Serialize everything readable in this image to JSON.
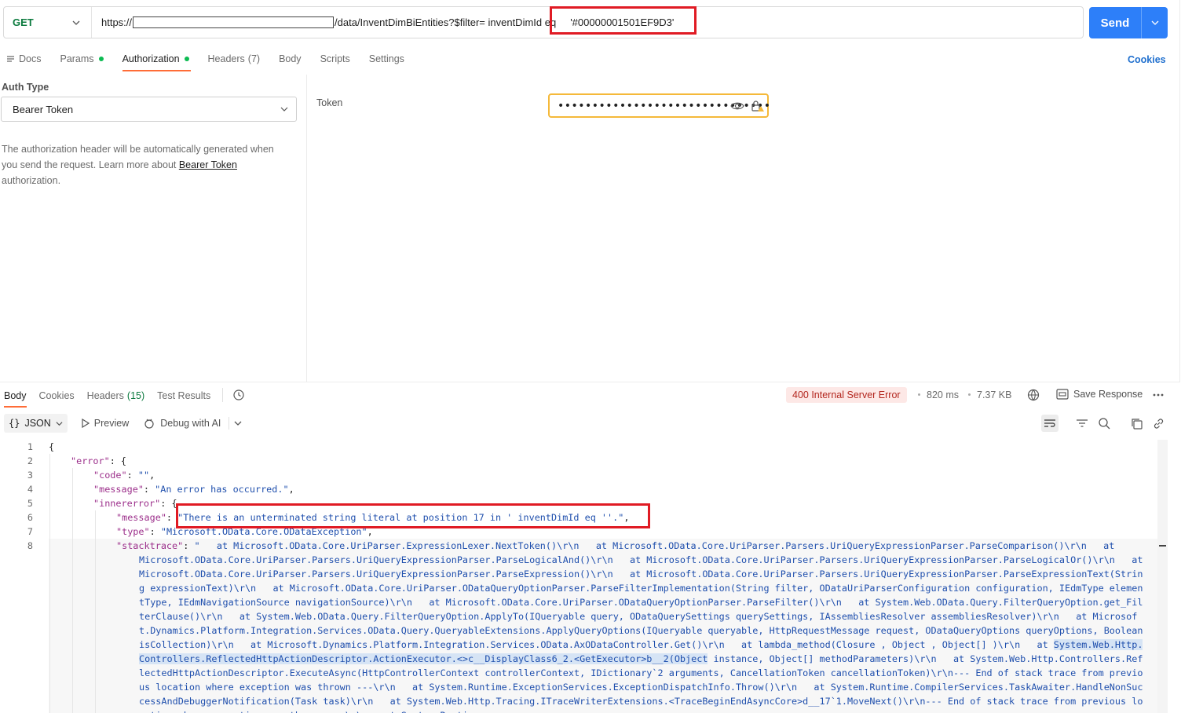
{
  "request": {
    "method": "GET",
    "url_prefix": "https://",
    "url_path": "/data/InventDimBiEntities?$filter= inventDimId eq",
    "filter_value": "'#00000001501EF9D3'",
    "send_label": "Send"
  },
  "req_tabs": {
    "docs": "Docs",
    "params": "Params",
    "authorization": "Authorization",
    "headers": "Headers",
    "headers_count": "(7)",
    "body": "Body",
    "scripts": "Scripts",
    "settings": "Settings",
    "cookies": "Cookies"
  },
  "auth": {
    "type_label": "Auth Type",
    "type_value": "Bearer Token",
    "desc_1": "The authorization header will be automatically generated when you send the request. Learn more about ",
    "desc_link": "Bearer Token",
    "desc_2": " authorization.",
    "token_label": "Token",
    "token_mask": "•••••••••••••••••••••••••••••••"
  },
  "response": {
    "tabs": {
      "body": "Body",
      "cookies": "Cookies",
      "headers": "Headers",
      "headers_count": "(15)",
      "test_results": "Test Results"
    },
    "status": "400 Internal Server Error",
    "time": "820 ms",
    "size": "7.37 KB",
    "save": "Save Response",
    "format": "JSON",
    "preview": "Preview",
    "debug": "Debug with AI"
  },
  "code": {
    "line_numbers": [
      "1",
      "2",
      "3",
      "4",
      "5",
      "6",
      "7",
      "8"
    ],
    "l1": "{",
    "error_key": "\"error\"",
    "code_key": "\"code\"",
    "code_val": "\"\"",
    "message_key": "\"message\"",
    "message_val": "\"An error has occurred.\"",
    "inner_key": "\"innererror\"",
    "inner_msg_key": "\"message\"",
    "inner_msg_val": "\"There is an unterminated string literal at position 17 in ' inventDimId eq ''.\"",
    "type_key": "\"type\"",
    "type_val": "\"Microsoft.OData.Core.ODataException\"",
    "stack_key": "\"stacktrace\"",
    "stack_first": "\"   at Microsoft.OData.Core.UriParser.ExpressionLexer.NextToken()\\r\\n   at Microsoft.OData.Core.UriParser.Parsers.UriQueryExpressionParser.ParseComparison()\\r\\n   at",
    "stack_a": "Microsoft.OData.Core.UriParser.Parsers.UriQueryExpressionParser.ParseLogicalAnd()\\r\\n   at Microsoft.OData.Core.UriParser.Parsers.UriQueryExpressionParser.ParseLogicalOr()\\r\\n   at Microsoft.OData.Core.UriParser.Parsers.UriQueryExpressionParser.ParseExpression()\\r\\n   at Microsoft.OData.Core.UriParser.Parsers.UriQueryExpressionParser.ParseExpressionText(String expressionText)\\r\\n   at Microsoft.OData.Core.UriParser.ODataQueryOptionParser.ParseFilterImplementation(String filter, ODataUriParserConfiguration configuration, IEdmType elementType, IEdmNavigationSource navigationSource)\\r\\n   at Microsoft.OData.Core.UriParser.ODataQueryOptionParser.ParseFilter()\\r\\n   at System.Web.OData.Query.FilterQueryOption.get_FilterClause()\\r\\n   at System.Web.OData.Query.FilterQueryOption.ApplyTo(IQueryable query, ODataQuerySettings querySettings, IAssembliesResolver assembliesResolver)\\r\\n   at Microsoft.Dynamics.Platform.Integration.Services.OData.Query.QueryableExtensions.ApplyQueryOptions(IQueryable queryable, HttpRequestMessage request, ODataQueryOptions queryOptions, Boolean isCollection)\\r\\n   at Microsoft.Dynamics.Platform.Integration.Services.OData.AxODataController.Get()\\r\\n   at lambda_method(Closure , Object , Object[] )\\r\\n   at ",
    "stack_sel": "System.Web.Http.Controllers.ReflectedHttpActionDescriptor.ActionExecutor.<>c__DisplayClass6_2.<GetExecutor>b__2(Object",
    "stack_b": " instance, Object[] methodParameters)\\r\\n   at System.Web.Http.Controllers.ReflectedHttpActionDescriptor.ExecuteAsync(HttpControllerContext controllerContext, IDictionary`2 arguments, CancellationToken cancellationToken)\\r\\n--- End of stack trace from previous location where exception was thrown ---\\r\\n   at System.Runtime.ExceptionServices.ExceptionDispatchInfo.Throw()\\r\\n   at System.Runtime.CompilerServices.TaskAwaiter.HandleNonSuccessAndDebuggerNotification(Task task)\\r\\n   at System.Web.Http.Tracing.ITraceWriterExtensions.<TraceBeginEndAsyncCore>d__17`1.MoveNext()\\r\\n--- End of stack trace from previous location where exception was thrown ---\\r\\n   at System.Runtime"
  },
  "colors": {
    "accent": "#ff6c37",
    "send": "#2d7ff9",
    "highlight": "#e01b24",
    "get": "#0b7a3e"
  }
}
